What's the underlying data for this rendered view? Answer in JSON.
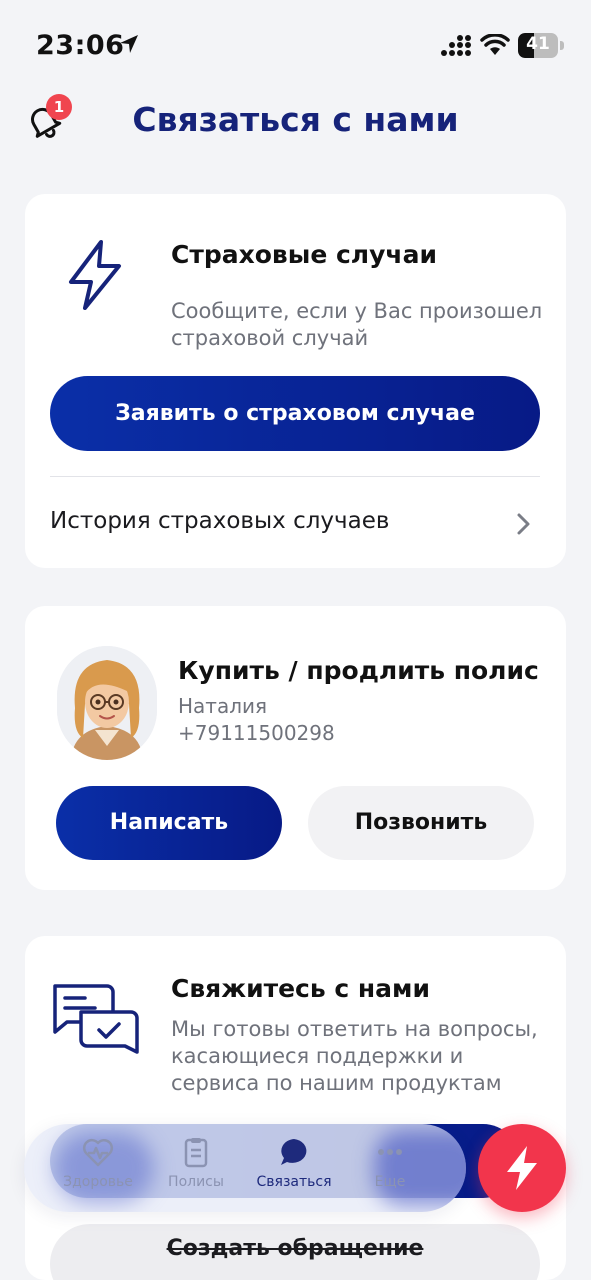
{
  "status_bar": {
    "time": "23:06",
    "battery": "41",
    "battery_level": 0.41
  },
  "header": {
    "title": "Связаться с нами",
    "notification_count": "1"
  },
  "insurance_card": {
    "title": "Страховые случаи",
    "description": "Сообщите, если у Вас произошел страховой случай",
    "report_button": "Заявить о страховом случае",
    "history_link": "История страховых случаев"
  },
  "agent_card": {
    "title": "Купить / продлить полис",
    "name": "Наталия",
    "phone": "+79111500298",
    "write_button": "Написать",
    "call_button": "Позвонить"
  },
  "contact_card": {
    "title": "Свяжитесь с нами",
    "description": "Мы готовы ответить на вопросы, касающиеся поддержки и сервиса по нашим продуктам",
    "create_request_button": "Создать обращение"
  },
  "tabbar": {
    "items": [
      {
        "label": "Здоровье",
        "icon": "heart-pulse-icon"
      },
      {
        "label": "Полисы",
        "icon": "clipboard-icon"
      },
      {
        "label": "Связаться",
        "icon": "chat-bubble-icon",
        "active": true
      },
      {
        "label": "Еще",
        "icon": "more-dots-icon"
      }
    ]
  },
  "colors": {
    "brand_blue": "#0a2fa8",
    "title_blue": "#16237a",
    "accent_red": "#f2354c",
    "badge_red": "#f0454f"
  }
}
